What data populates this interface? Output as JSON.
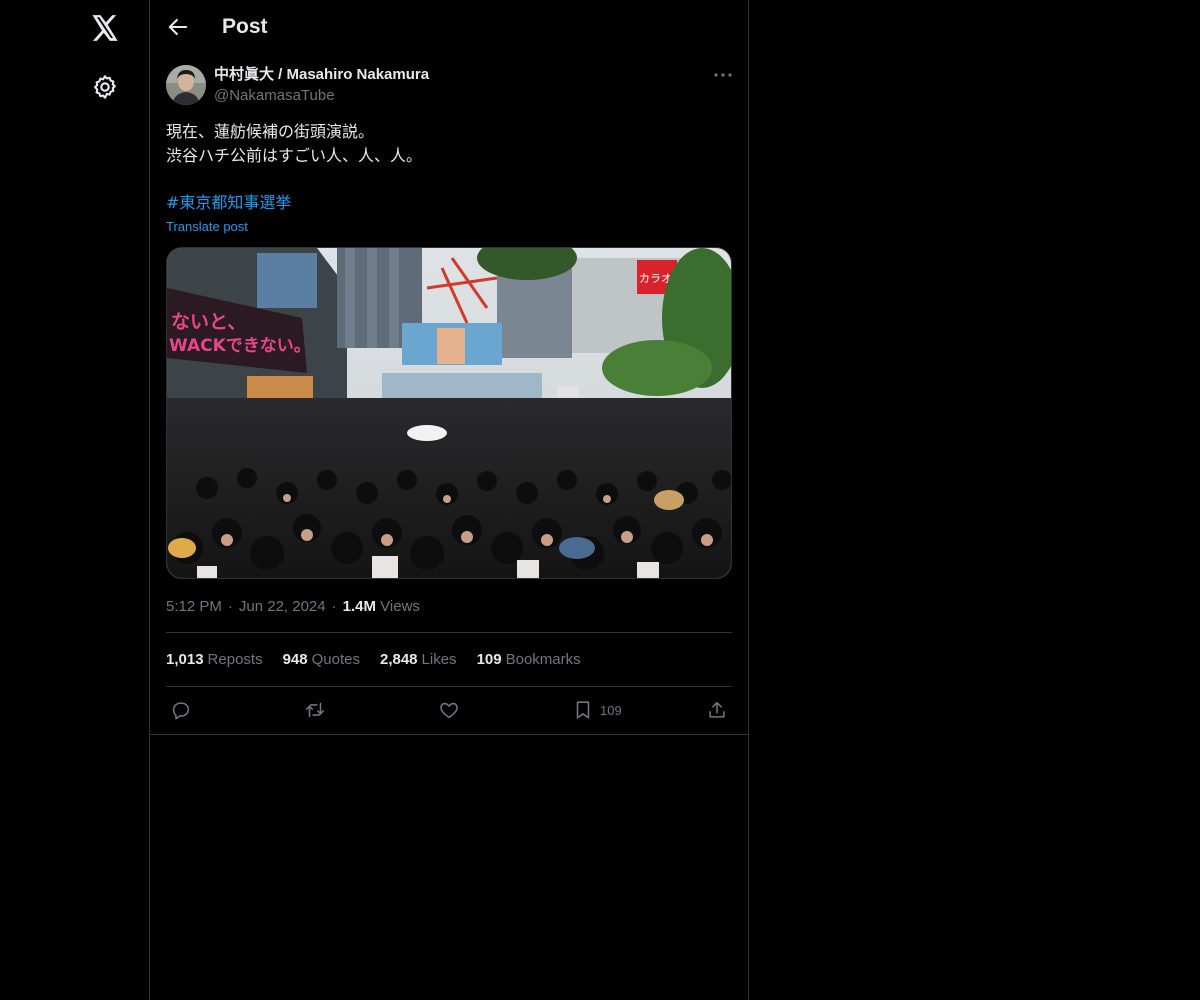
{
  "header": {
    "title": "Post",
    "back_icon": "arrow-left-icon"
  },
  "nav": {
    "logo_icon": "x-logo-icon",
    "settings_icon": "gear-icon"
  },
  "post": {
    "author": {
      "display_name": "中村眞大 / Masahiro Nakamura",
      "handle": "@NakamasaTube"
    },
    "text_lines": [
      "現在、蓮舫候補の街頭演説。",
      "渋谷ハチ公前はすごい人、人、人。"
    ],
    "hashtag": "#東京都知事選挙",
    "translate_label": "Translate post",
    "meta": {
      "time": "5:12 PM",
      "date": "Jun 22, 2024",
      "views_count": "1.4M",
      "views_label": "Views",
      "separator": "·"
    },
    "stats": [
      {
        "count": "1,013",
        "label": "Reposts"
      },
      {
        "count": "948",
        "label": "Quotes"
      },
      {
        "count": "2,848",
        "label": "Likes"
      },
      {
        "count": "109",
        "label": "Bookmarks"
      }
    ],
    "actions": {
      "bookmark_count": "109"
    },
    "media_image_text": {
      "billboard_left_1": "ないと、",
      "billboard_left_2": "WACKできない。",
      "billboard_right": "カラオケ"
    }
  },
  "colors": {
    "background": "#000000",
    "text_primary": "#e7e9ea",
    "text_secondary": "#71767b",
    "accent": "#1d9bf0",
    "border": "#2f3336"
  }
}
